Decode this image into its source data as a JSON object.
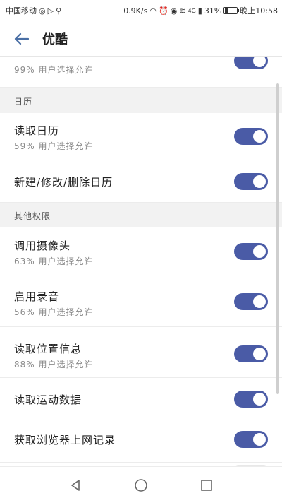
{
  "status_bar": {
    "carrier": "中国移动",
    "network_speed": "0.9K/s",
    "signal_label": "4G",
    "battery_percent": "31%",
    "battery_level": 0.31,
    "time": "晚上10:58"
  },
  "app_bar": {
    "back_icon": "arrow-left-icon",
    "title": "优酷"
  },
  "partial_item": {
    "subtitle": "99% 用户选择允许",
    "enabled": true
  },
  "sections": [
    {
      "header": "日历",
      "items": [
        {
          "title": "读取日历",
          "subtitle": "59% 用户选择允许",
          "enabled": true
        },
        {
          "title": "新建/修改/删除日历",
          "subtitle": "",
          "enabled": true
        }
      ]
    },
    {
      "header": "其他权限",
      "items": [
        {
          "title": "调用摄像头",
          "subtitle": "63% 用户选择允许",
          "enabled": true
        },
        {
          "title": "启用录音",
          "subtitle": "56% 用户选择允许",
          "enabled": true
        },
        {
          "title": "读取位置信息",
          "subtitle": "88% 用户选择允许",
          "enabled": true
        },
        {
          "title": "读取运动数据",
          "subtitle": "",
          "enabled": true
        },
        {
          "title": "获取浏览器上网记录",
          "subtitle": "",
          "enabled": true
        }
      ]
    }
  ],
  "nav_bar": {
    "back_icon": "triangle-back-icon",
    "home_icon": "circle-home-icon",
    "recents_icon": "square-recents-icon"
  },
  "colors": {
    "toggle_on": "#4a5ba6",
    "section_bg": "#f2f2f2"
  }
}
